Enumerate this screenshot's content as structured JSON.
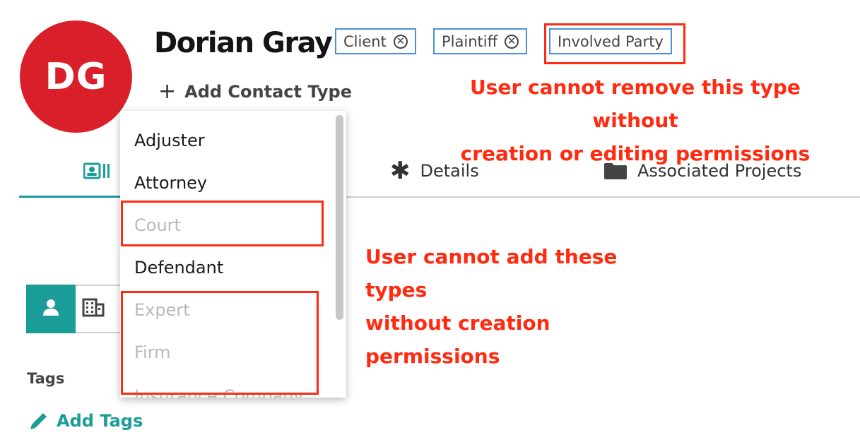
{
  "contact": {
    "initials": "DG",
    "name": "Dorian Gray",
    "avatar_color": "#d9202a"
  },
  "types": [
    {
      "label": "Client",
      "removable": true
    },
    {
      "label": "Plaintiff",
      "removable": true
    },
    {
      "label": "Involved Party",
      "removable": false
    }
  ],
  "add_contact_type_label": "Add Contact Type",
  "dropdown": {
    "options": [
      {
        "label": "Adjuster",
        "enabled": true
      },
      {
        "label": "Attorney",
        "enabled": true
      },
      {
        "label": "Court",
        "enabled": false
      },
      {
        "label": "Defendant",
        "enabled": true
      },
      {
        "label": "Expert",
        "enabled": false
      },
      {
        "label": "Firm",
        "enabled": false
      },
      {
        "label": "Insurance Company",
        "enabled": false
      }
    ]
  },
  "tabs": [
    {
      "label": "Details",
      "icon": "asterisk-icon"
    },
    {
      "label": "Associated Projects",
      "icon": "folder-icon"
    }
  ],
  "annotations": {
    "remove_type_line1": "User cannot remove this type without",
    "remove_type_line2": "creation or editing permissions",
    "add_types_line1": "User cannot add these types",
    "add_types_line2": "without creation permissions"
  },
  "tags": {
    "label": "Tags",
    "add_label": "Add Tags"
  },
  "colors": {
    "accent": "#1a9c98",
    "annotation": "#ff2a0f",
    "chip_border": "#4a90d9"
  }
}
